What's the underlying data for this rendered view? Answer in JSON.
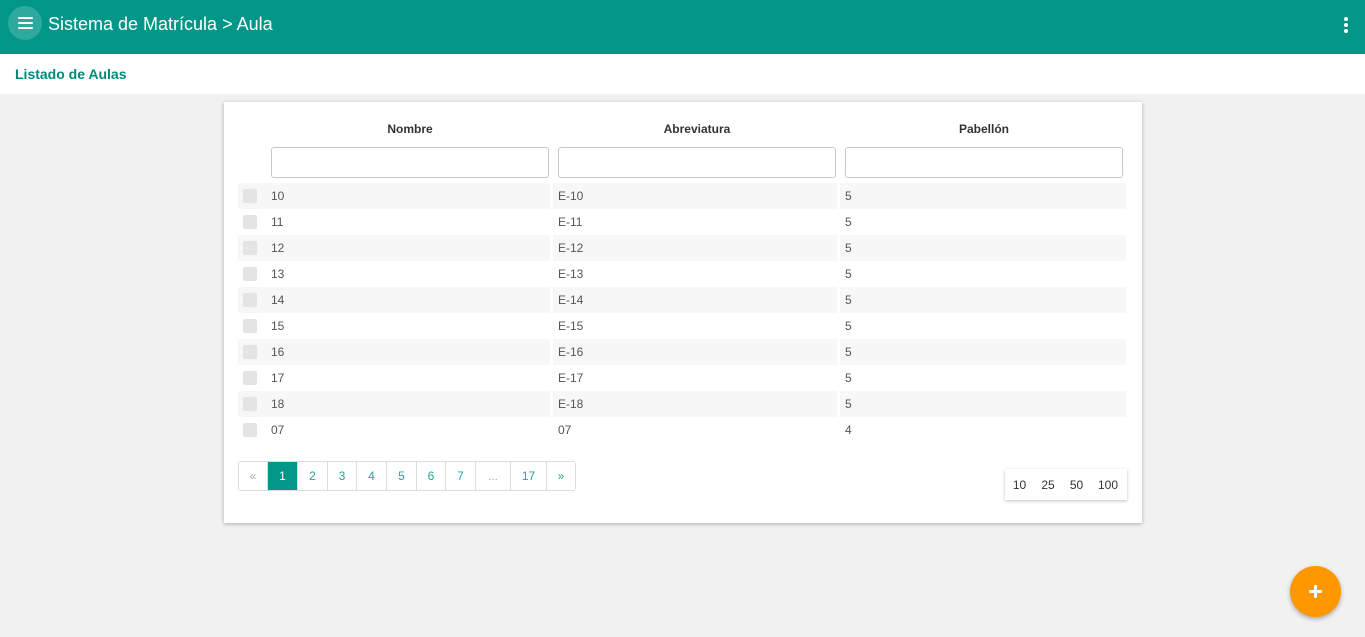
{
  "app": {
    "title": "Sistema de Matrícula > Aula"
  },
  "header": {
    "menu_icon": "hamburger-menu-icon",
    "more_icon": "more-vert-icon"
  },
  "page": {
    "title": "Listado de Aulas"
  },
  "table": {
    "columns": [
      "Nombre",
      "Abreviatura",
      "Pabellón"
    ],
    "filters": [
      "",
      "",
      ""
    ],
    "rows": [
      [
        "10",
        "E-10",
        "5"
      ],
      [
        "11",
        "E-11",
        "5"
      ],
      [
        "12",
        "E-12",
        "5"
      ],
      [
        "13",
        "E-13",
        "5"
      ],
      [
        "14",
        "E-14",
        "5"
      ],
      [
        "15",
        "E-15",
        "5"
      ],
      [
        "16",
        "E-16",
        "5"
      ],
      [
        "17",
        "E-17",
        "5"
      ],
      [
        "18",
        "E-18",
        "5"
      ],
      [
        "07",
        "07",
        "4"
      ]
    ]
  },
  "pagination": {
    "prev": "«",
    "next": "»",
    "pages": [
      "1",
      "2",
      "3",
      "4",
      "5",
      "6",
      "7",
      "...",
      "17"
    ],
    "active": "1"
  },
  "page_size": {
    "options": [
      "10",
      "25",
      "50",
      "100"
    ]
  },
  "fab": {
    "icon": "plus-icon"
  },
  "colors": {
    "primary": "#009688",
    "accent": "#ff9800",
    "title": "#00897b"
  }
}
